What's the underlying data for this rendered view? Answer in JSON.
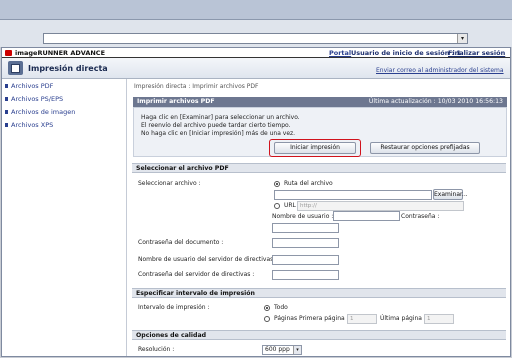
{
  "browser": {
    "address_value": "",
    "dropdown_glyph": "▾"
  },
  "header": {
    "brand": "imageRUNNER ADVANCE",
    "portal_link": "Portal",
    "user_text": "Usuario de inicio de sesión : 1",
    "logout_link": "Finalizar sesión",
    "app_title": "Impresión directa",
    "admin_link": "Enviar correo al administrador del sistema"
  },
  "sidebar": {
    "items": [
      {
        "label": "Archivos PDF"
      },
      {
        "label": "Archivos PS/EPS"
      },
      {
        "label": "Archivos de imagen"
      },
      {
        "label": "Archivos XPS"
      }
    ]
  },
  "main": {
    "breadcrumb": "Impresión directa : Imprimir archivos PDF",
    "section_title": "Imprimir archivos PDF",
    "last_update": "Última actualización : 10/03 2010 16:56:13",
    "info_lines": [
      "Haga clic en [Examinar] para seleccionar un archivo.",
      "El reenvío del archivo puede tardar cierto tiempo.",
      "No haga clic en [Iniciar impresión] más de una vez."
    ],
    "start_button": "Iniciar impresión",
    "restore_button": "Restaurar opciones prefijadas",
    "select_pdf_header": "Seleccionar el archivo PDF",
    "select_file_label": "Seleccionar archivo :",
    "path_radio_label": "Ruta del archivo",
    "browse_button": "Examinar...",
    "url_radio_label": "URL",
    "url_placeholder": "http://",
    "username_label": "Nombre de usuario :",
    "password_label": "Contraseña :",
    "doc_password_label": "Contraseña del documento :",
    "policy_user_label": "Nombre de usuario del servidor de directivas :",
    "policy_pass_label": "Contraseña del servidor de directivas :",
    "print_range_header": "Especificar intervalo de impresión",
    "print_range_label": "Intervalo de impresión :",
    "all_label": "Todo",
    "pages_label": "Páginas Primera página :",
    "first_page_value": "1",
    "last_page_label": "Última página :",
    "last_page_value": "1",
    "quality_header": "Opciones de calidad",
    "resolution_label": "Resolución :",
    "resolution_value": "600 ppp"
  }
}
